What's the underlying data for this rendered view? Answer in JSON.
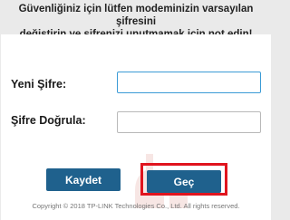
{
  "notice": {
    "line1": "Güvenliğiniz için lütfen modeminizin varsayılan şifresini",
    "line2": "değiştirin ve şifrenizi unutmamak için not edin!"
  },
  "form": {
    "new_password_label": "Yeni Şifre:",
    "new_password_value": "",
    "confirm_password_label": "Şifre Doğrula:",
    "confirm_password_value": ""
  },
  "buttons": {
    "save_label": "Kaydet",
    "skip_label": "Geç"
  },
  "footer": {
    "copyright": "Copyright © 2018 TP-LINK Technologies Co., Ltd. All rights reserved."
  },
  "colors": {
    "button_bg": "#1f618d",
    "highlight": "#e0141e",
    "focus_border": "#3b9bd6"
  }
}
